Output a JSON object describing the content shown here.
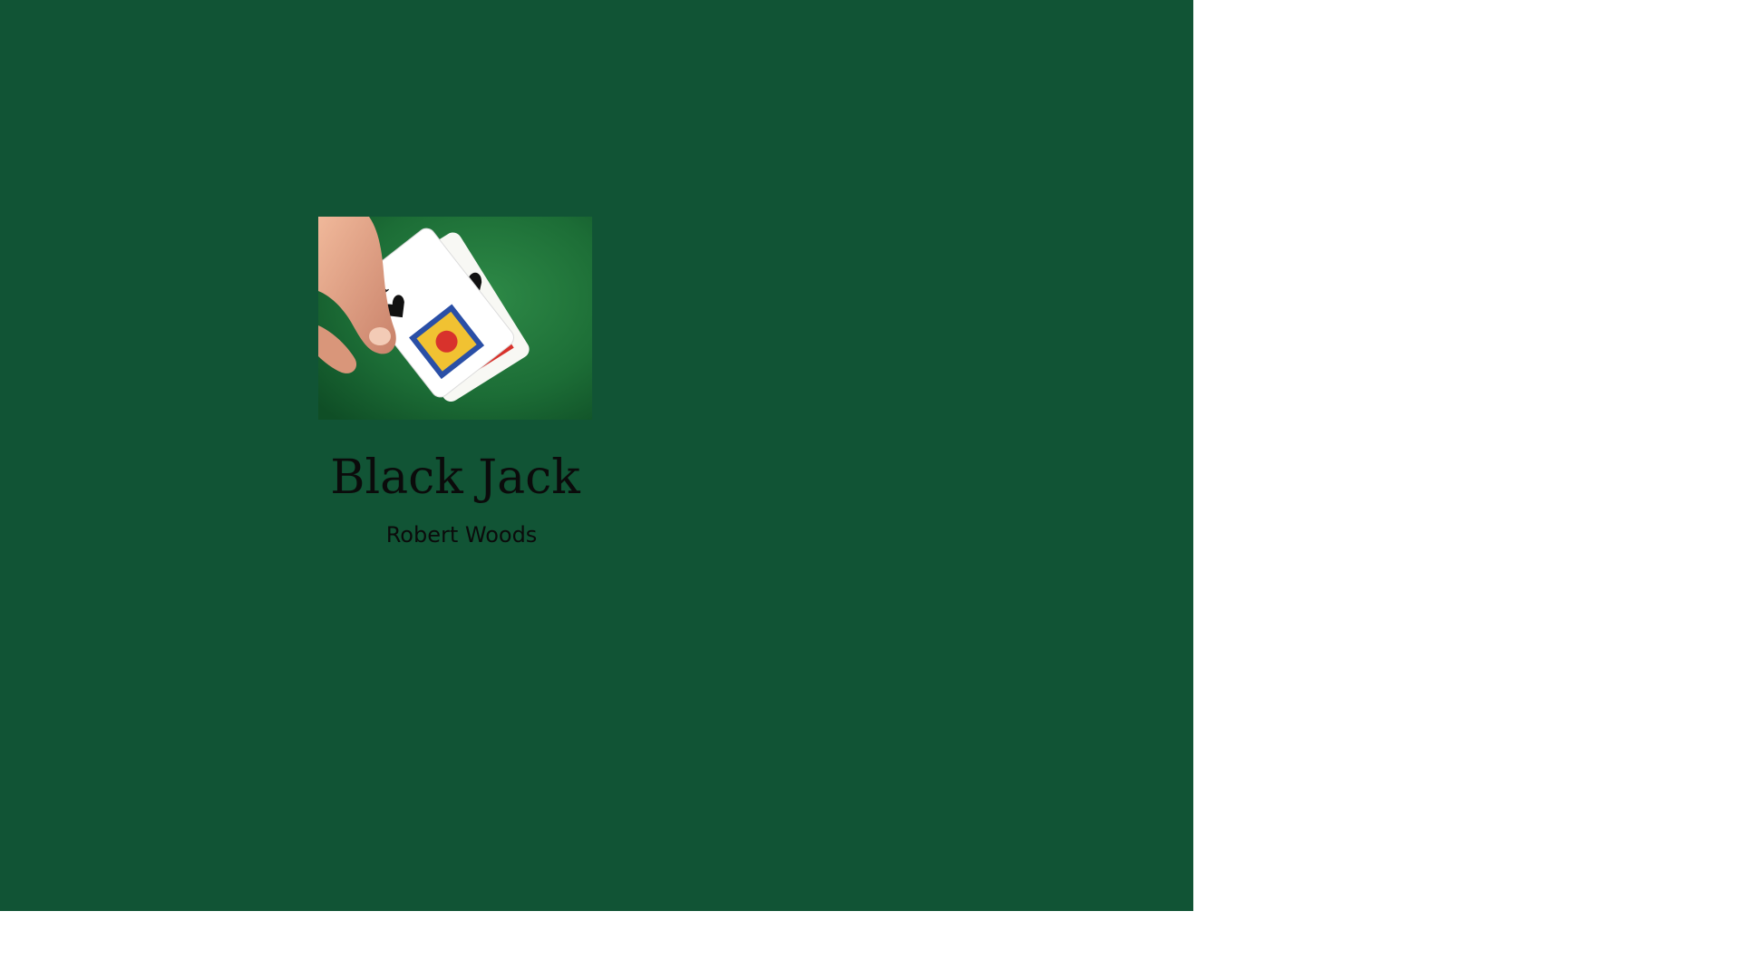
{
  "book": {
    "title": "Black Jack",
    "author": "Robert Woods"
  },
  "cover_image": {
    "subject": "hand lifting ace of spades and jack of spades on green felt"
  },
  "colors": {
    "page_background": "#115435",
    "outer_background": "#ffffff",
    "text": "#0b0b0b"
  }
}
